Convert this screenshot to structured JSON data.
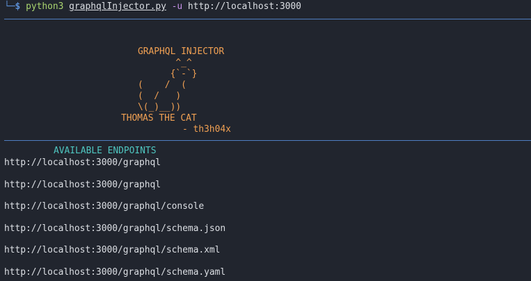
{
  "prompt": {
    "corner": "└─",
    "symbol": "$",
    "program": "python3",
    "script": "graphqlInjector.py",
    "flag": "-u",
    "url": "http://localhost:3000"
  },
  "banner": {
    "title": "GRAPHQL INJECTOR",
    "art": [
      "       ^_^",
      "      {`-`}",
      "(    /  (",
      "(  /   )",
      "\\(_)__))"
    ],
    "name": "THOMAS THE CAT",
    "author": "- th3h04x"
  },
  "endpoints": {
    "heading": "AVAILABLE ENDPOINTS",
    "items": [
      "http://localhost:3000/graphql",
      "http://localhost:3000/graphql",
      "http://localhost:3000/graphql/console",
      "http://localhost:3000/graphql/schema.json",
      "http://localhost:3000/graphql/schema.xml",
      "http://localhost:3000/graphql/schema.yaml"
    ]
  },
  "colors": {
    "background": "#21252e",
    "prompt": "#5b8fd6",
    "command": "#a9d46f",
    "flag": "#c792ea",
    "banner": "#f0a053",
    "heading": "#4fc6c0",
    "text": "#dcdfe4",
    "divider": "#4f7ec2"
  }
}
